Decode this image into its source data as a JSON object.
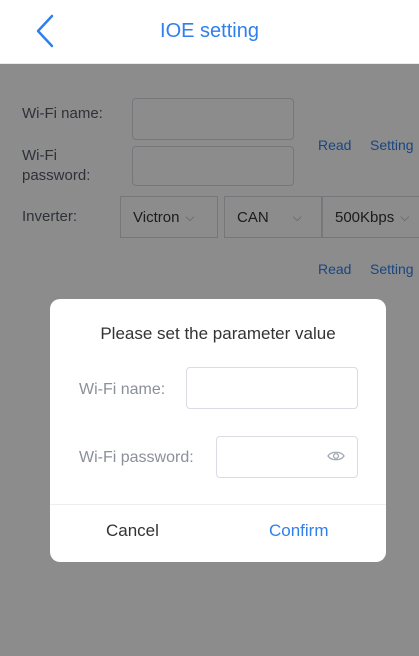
{
  "header": {
    "title": "IOE setting"
  },
  "form": {
    "wifi_name_label": "Wi-Fi name:",
    "wifi_password_label": "Wi-Fi\npassword:",
    "read_label": "Read",
    "setting_label": "Setting",
    "inverter_label": "Inverter:",
    "inverter_brand": "Victron",
    "protocol": "CAN",
    "baud_rate": "500Kbps",
    "read_label_2": "Read",
    "setting_label_2": "Setting"
  },
  "dialog": {
    "title": "Please set the parameter value",
    "wifi_name_label": "Wi-Fi name:",
    "wifi_name_value": "",
    "wifi_password_label": "Wi-Fi password:",
    "wifi_password_value": "",
    "cancel_label": "Cancel",
    "confirm_label": "Confirm"
  },
  "colors": {
    "accent": "#2f80ed",
    "overlay": "rgba(0,0,0,0.45)"
  },
  "icons": {
    "back": "chevron-left-icon",
    "caret": "chevron-down-icon",
    "eye": "eye-icon"
  }
}
